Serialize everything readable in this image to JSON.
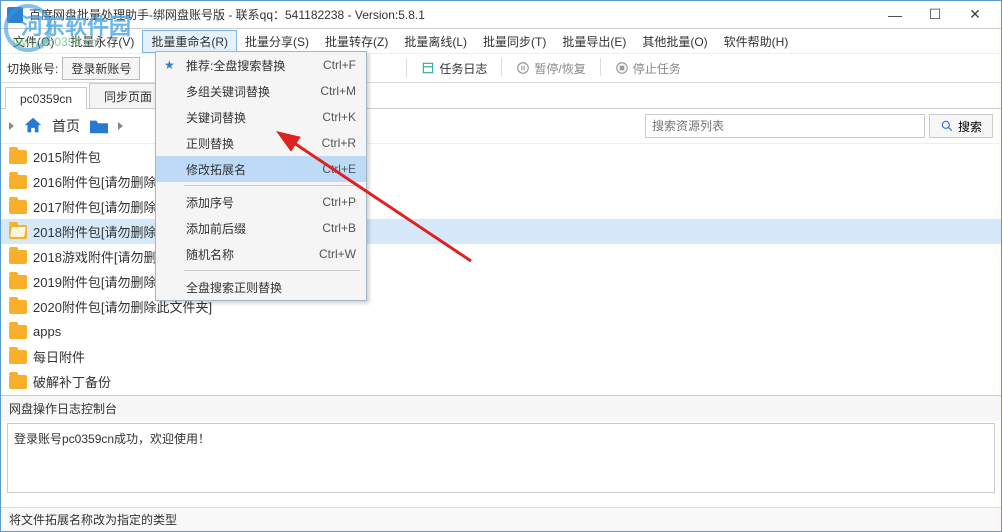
{
  "window": {
    "title": "百度网盘批量处理助手-绑网盘账号版 - 联系qq：541182238 - Version:5.8.1"
  },
  "menubar": {
    "items": [
      {
        "label": "文件(O)"
      },
      {
        "label": "批量永存(V)"
      },
      {
        "label": "批量重命名(R)"
      },
      {
        "label": "批量分享(S)"
      },
      {
        "label": "批量转存(Z)"
      },
      {
        "label": "批量离线(L)"
      },
      {
        "label": "批量同步(T)"
      },
      {
        "label": "批量导出(E)"
      },
      {
        "label": "其他批量(O)"
      },
      {
        "label": "软件帮助(H)"
      }
    ],
    "open_index": 2
  },
  "toolbar": {
    "switch_label": "切换账号:",
    "login_button": "登录新账号",
    "buttons": [
      {
        "label": "任务日志",
        "active": true
      },
      {
        "label": "暂停/恢复",
        "active": false
      },
      {
        "label": "停止任务",
        "active": false
      }
    ]
  },
  "tabs": {
    "items": [
      "pc0359cn",
      "同步页面"
    ],
    "active": 0
  },
  "breadcrumb": {
    "home_label": "首页",
    "search_placeholder": "搜索资源列表",
    "search_button": "搜索"
  },
  "files": [
    {
      "name": "2015附件包",
      "selected": false
    },
    {
      "name": "2016附件包[请勿删除此文件夹]",
      "selected": false
    },
    {
      "name": "2017附件包[请勿删除此文件夹]",
      "selected": false
    },
    {
      "name": "2018附件包[请勿删除此文件夹]",
      "selected": true
    },
    {
      "name": "2018游戏附件[请勿删除此文件夹]",
      "selected": false
    },
    {
      "name": "2019附件包[请勿删除此文件夹]",
      "selected": false
    },
    {
      "name": "2020附件包[请勿删除此文件夹]",
      "selected": false
    },
    {
      "name": "apps",
      "selected": false
    },
    {
      "name": "每日附件",
      "selected": false
    },
    {
      "name": "破解补丁备份",
      "selected": false
    }
  ],
  "log": {
    "header": "网盘操作日志控制台",
    "content": "登录账号pc0359cn成功，欢迎使用！"
  },
  "statusbar": {
    "text": "将文件拓展名称改为指定的类型"
  },
  "dropdown": {
    "selected_index": 4,
    "groups": [
      [
        {
          "label": "推荐:全盘搜索替换",
          "shortcut": "Ctrl+F",
          "star": true
        },
        {
          "label": "多组关键词替换",
          "shortcut": "Ctrl+M"
        },
        {
          "label": "关键词替换",
          "shortcut": "Ctrl+K"
        },
        {
          "label": "正则替换",
          "shortcut": "Ctrl+R"
        },
        {
          "label": "修改拓展名",
          "shortcut": "Ctrl+E"
        }
      ],
      [
        {
          "label": "添加序号",
          "shortcut": "Ctrl+P"
        },
        {
          "label": "添加前后缀",
          "shortcut": "Ctrl+B"
        },
        {
          "label": "随机名称",
          "shortcut": "Ctrl+W"
        }
      ],
      [
        {
          "label": "全盘搜索正则替换",
          "shortcut": ""
        }
      ]
    ]
  },
  "watermark": {
    "line1": "河东软件园",
    "line2": "www.pc0359.cn"
  }
}
